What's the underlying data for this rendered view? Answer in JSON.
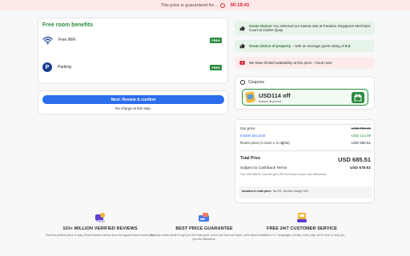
{
  "topbar": {
    "message": "This price is guaranteed for...",
    "timer": "00:19:41"
  },
  "benefits": {
    "title": "Free room benefits",
    "items": [
      {
        "icon": "wifi-icon",
        "label": "Free WiFi",
        "tag": "FREE"
      },
      {
        "icon": "parking-icon",
        "label": "Parking",
        "tag": "FREE"
      }
    ]
  },
  "next": {
    "button_label": "Next: Review & confirm",
    "note": "No charge at this step"
  },
  "alerts": [
    {
      "type": "green",
      "icon": "thumbs-up-icon",
      "bold": "Great choice!",
      "text": " You selected our lowest rate at Paradox Singapore Merchant Court at Clarke Quay"
    },
    {
      "type": "green",
      "icon": "thumbs-up-icon",
      "bold": "Great choice of property",
      "text": " – with an average guest rating of ",
      "rating": "8.6"
    },
    {
      "type": "red",
      "icon": "alert-icon",
      "bold": "",
      "text": "We have limited availability at this price – book now!"
    }
  ],
  "coupons": {
    "title": "Coupons",
    "amount": "USD114 off",
    "sub": "Instant discount"
  },
  "price": {
    "our_price_label": "Our price",
    "our_price_value": "USD 799.45",
    "instant_discount_label": "Instant discount",
    "instant_discount_value": "-USD 113.99",
    "room_price_label": "Room price (1 room x 3 nights)",
    "room_price_value": "USD 685.51",
    "total_label": "Total Price",
    "total_value": "USD 685.51",
    "cashback_label": "Subject to Cashback Terms",
    "cashback_value": "USD 678.92",
    "pay_note": "Pay USD 685.51 now and get USD 6.59 back to your card afterwards",
    "included_bold": "Included in total price:",
    "included_text": " Tax 9%, Service charge 10%"
  },
  "features": [
    {
      "icon": "review-icon",
      "title": "103+ MILLION VERIFIED REVIEWS",
      "text": "Find the perfect place to stay. Read honest reviews from the Agoda travel community."
    },
    {
      "icon": "price-guarantee-icon",
      "title": "BEST PRICE GUARANTEE",
      "text": "Nobody works harder to get you the best price. And if you find one lower, we'll refund you the difference."
    },
    {
      "icon": "customer-service-icon",
      "title": "FREE 24/7 CUSTOMER SERVICE",
      "text": "Available in 17 languages. All day, every day, we're here to help you."
    }
  ],
  "colors": {
    "accent": "#2c6ded",
    "success": "#2b8a3e",
    "danger": "#d3292f"
  }
}
